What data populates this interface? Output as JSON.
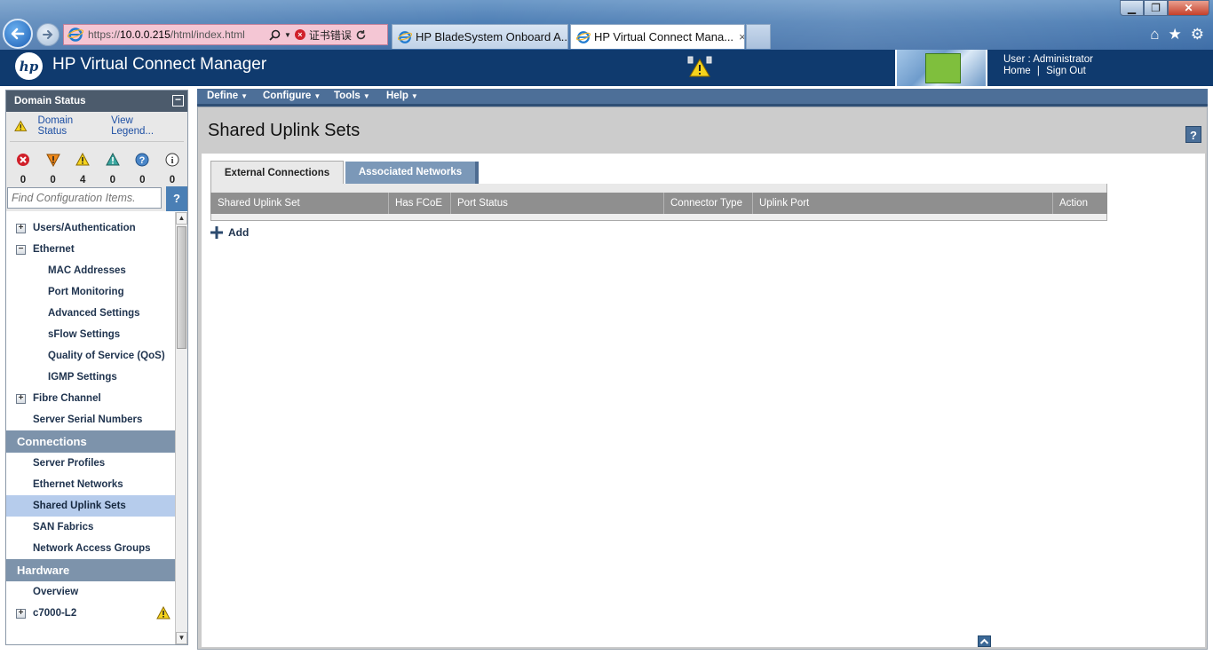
{
  "browser": {
    "address_host": "10.0.0.215",
    "address_prefix": "https://",
    "address_path": "/html/index.html",
    "cert_error": "证书错误",
    "tabs": [
      {
        "label": "HP BladeSystem Onboard A..."
      },
      {
        "label": "HP Virtual Connect Mana..."
      }
    ],
    "tab_close": "×",
    "win_min": "▁",
    "win_max": "❐",
    "win_close": "✕",
    "icons": {
      "home": "⌂",
      "favorites": "★",
      "settings": "⚙"
    }
  },
  "header": {
    "logo": "hp",
    "title": "HP Virtual Connect Manager",
    "user_label": "User : Administrator",
    "home_link": "Home",
    "separator": "|",
    "sign_out_link": "Sign Out"
  },
  "domain_status": {
    "title": "Domain Status",
    "collapse": "−",
    "links": [
      "Domain Status",
      "View Legend..."
    ],
    "counts": [
      {
        "icon": "critical-icon",
        "count": "0"
      },
      {
        "icon": "major-icon",
        "count": "0"
      },
      {
        "icon": "warning-icon",
        "count": "4"
      },
      {
        "icon": "minor-icon",
        "count": "0"
      },
      {
        "icon": "unknown-icon",
        "count": "0"
      },
      {
        "icon": "info-icon",
        "count": "0"
      }
    ]
  },
  "search": {
    "placeholder": "Find Configuration Items.",
    "button": "?"
  },
  "tree": {
    "users_auth": "Users/Authentication",
    "ethernet": "Ethernet",
    "mac_addresses": "MAC Addresses",
    "port_monitoring": "Port Monitoring",
    "advanced_settings": "Advanced Settings",
    "sflow_settings": "sFlow Settings",
    "qos": "Quality of Service (QoS)",
    "igmp": "IGMP Settings",
    "fibre_channel": "Fibre Channel",
    "server_serial": "Server Serial Numbers",
    "connections": "Connections",
    "server_profiles": "Server Profiles",
    "ethernet_networks": "Ethernet Networks",
    "shared_uplink_sets": "Shared Uplink Sets",
    "san_fabrics": "SAN Fabrics",
    "network_access_groups": "Network Access Groups",
    "hardware": "Hardware",
    "overview": "Overview",
    "enclosure": "c7000-L2",
    "expand": "+",
    "collapse": "−"
  },
  "menubar": {
    "items": [
      "Define",
      "Configure",
      "Tools",
      "Help"
    ],
    "caret": "▼"
  },
  "main": {
    "page_title": "Shared Uplink Sets",
    "help": "?",
    "tabs": [
      "External Connections",
      "Associated Networks"
    ],
    "columns": [
      "Shared Uplink Set",
      "Has FCoE",
      "Port Status",
      "Connector Type",
      "Uplink Port",
      "Action"
    ],
    "add_label": "Add"
  },
  "colors": {
    "header_bg": "#0f3a6e",
    "menubar_bg": "#4d6f98",
    "section_bg": "#7d93ab",
    "selected_bg": "#b6ccec",
    "grid_header_bg": "#8f8f8f"
  }
}
